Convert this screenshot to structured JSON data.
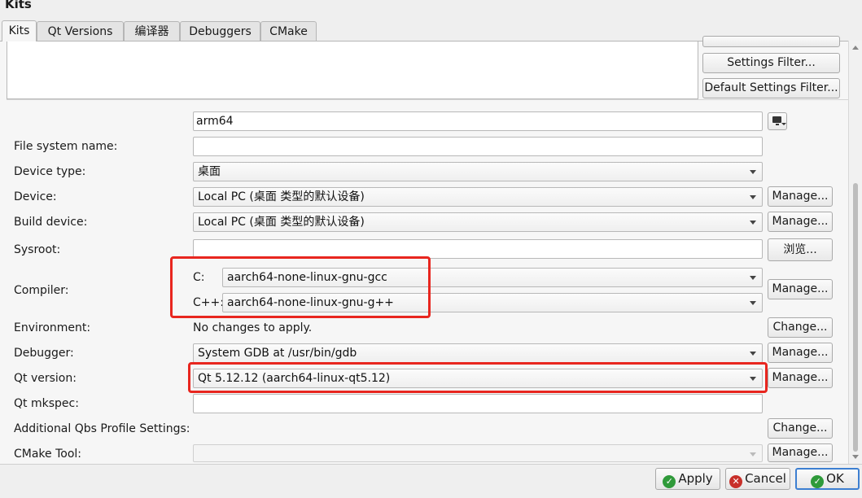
{
  "window": {
    "title": "Kits"
  },
  "tabs": [
    {
      "label": "Kits",
      "active": true
    },
    {
      "label": "Qt Versions"
    },
    {
      "label": "编译器"
    },
    {
      "label": "Debuggers"
    },
    {
      "label": "CMake"
    }
  ],
  "side_buttons": {
    "settings_filter": "Settings Filter...",
    "default_settings_filter": "Default Settings Filter..."
  },
  "form": {
    "name_value": "arm64",
    "file_system_name": {
      "label": "File system name:",
      "value": ""
    },
    "device_type": {
      "label": "Device type:",
      "value": "桌面"
    },
    "device": {
      "label": "Device:",
      "value": "Local PC (桌面 类型的默认设备)",
      "button": "Manage..."
    },
    "build_device": {
      "label": "Build device:",
      "value": "Local PC (桌面 类型的默认设备)",
      "button": "Manage..."
    },
    "sysroot": {
      "label": "Sysroot:",
      "value": "",
      "button": "浏览..."
    },
    "compiler": {
      "label": "Compiler:",
      "c_label": "C:",
      "c_value": "aarch64-none-linux-gnu-gcc",
      "cpp_label": "C++:",
      "cpp_value": "aarch64-none-linux-gnu-g++",
      "button": "Manage..."
    },
    "environment": {
      "label": "Environment:",
      "value": "No changes to apply.",
      "button": "Change..."
    },
    "debugger": {
      "label": "Debugger:",
      "value": "System GDB at /usr/bin/gdb",
      "button": "Manage..."
    },
    "qt_version": {
      "label": "Qt version:",
      "value": "Qt 5.12.12 (aarch64-linux-qt5.12)",
      "button": "Manage..."
    },
    "qt_mkspec": {
      "label": "Qt mkspec:",
      "value": ""
    },
    "qbs_profile": {
      "label": "Additional Qbs Profile Settings:",
      "button": "Change..."
    },
    "cmake_tool": {
      "label": "CMake Tool:",
      "value": "",
      "button": "Manage..."
    }
  },
  "dialog_buttons": {
    "apply": "Apply",
    "cancel": "Cancel",
    "ok": "OK"
  },
  "colors": {
    "highlight_box": "#e8261f",
    "ok_border": "#3d7fd1"
  }
}
